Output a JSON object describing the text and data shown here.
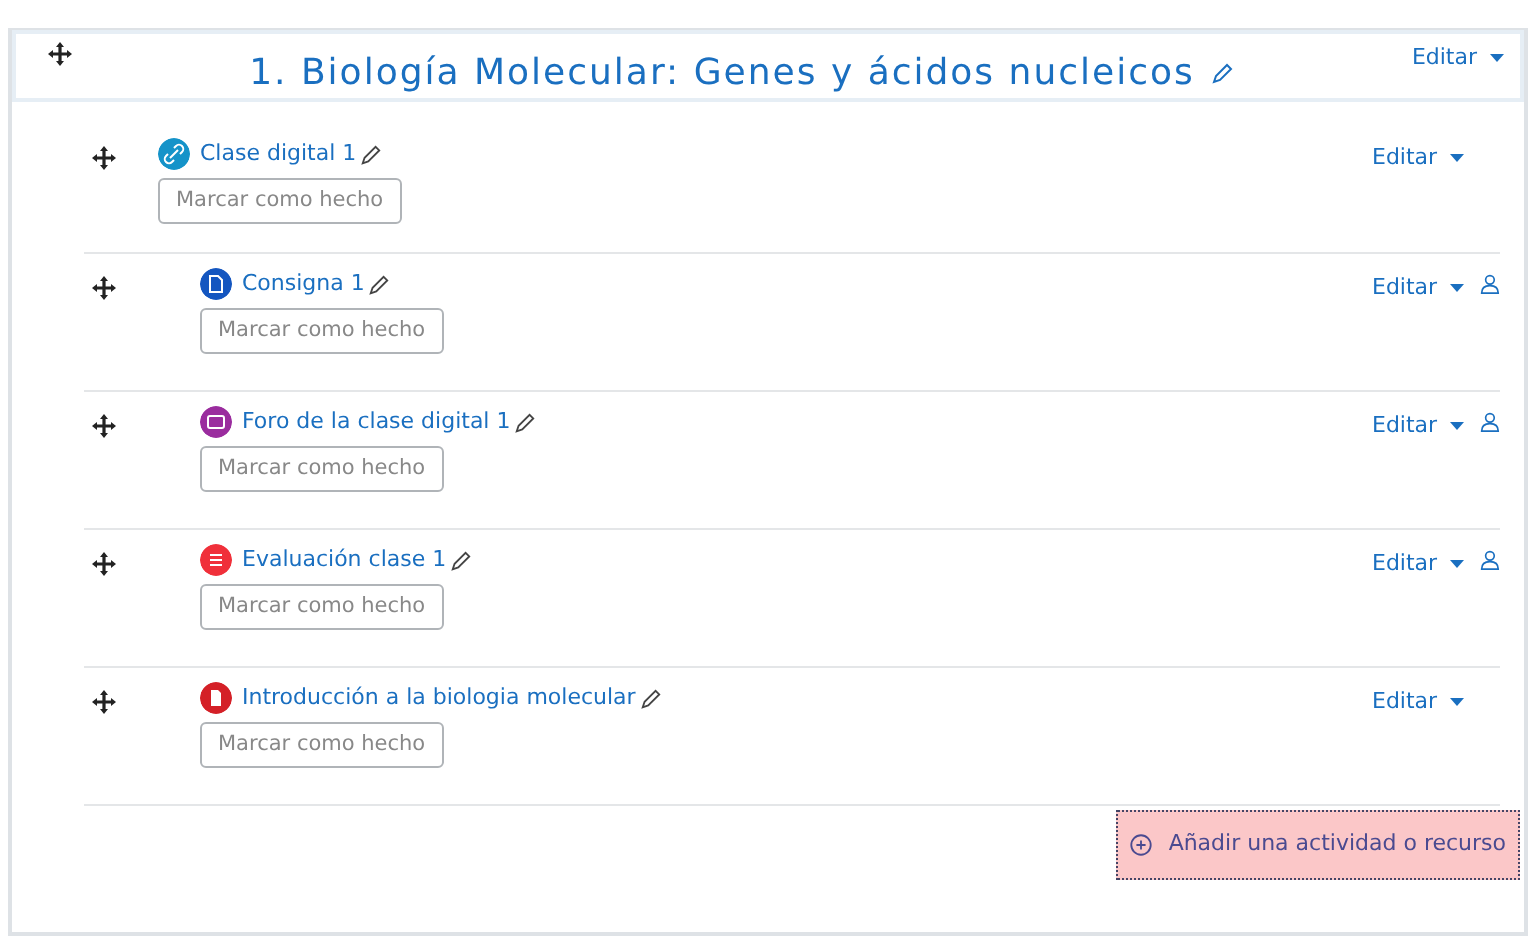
{
  "section": {
    "title": "1. Biología Molecular: Genes y ácidos nucleicos",
    "edit_menu": "Editar"
  },
  "activities": [
    {
      "kind": "url",
      "name": "Clase digital 1",
      "indented": false,
      "restricted": false,
      "edit_menu": "Editar",
      "completion_button": "Marcar como hecho"
    },
    {
      "kind": "assign",
      "name": "Consigna 1",
      "indented": true,
      "restricted": true,
      "edit_menu": "Editar",
      "completion_button": "Marcar como hecho"
    },
    {
      "kind": "forum",
      "name": "Foro de la clase digital 1",
      "indented": true,
      "restricted": true,
      "edit_menu": "Editar",
      "completion_button": "Marcar como hecho"
    },
    {
      "kind": "quiz",
      "name": "Evaluación clase 1",
      "indented": true,
      "restricted": true,
      "edit_menu": "Editar",
      "completion_button": "Marcar como hecho"
    },
    {
      "kind": "resource",
      "name": "Introducción a la biologia molecular",
      "indented": true,
      "restricted": false,
      "edit_menu": "Editar",
      "completion_button": "Marcar como hecho"
    }
  ],
  "add_button": "Añadir una actividad o recurso"
}
